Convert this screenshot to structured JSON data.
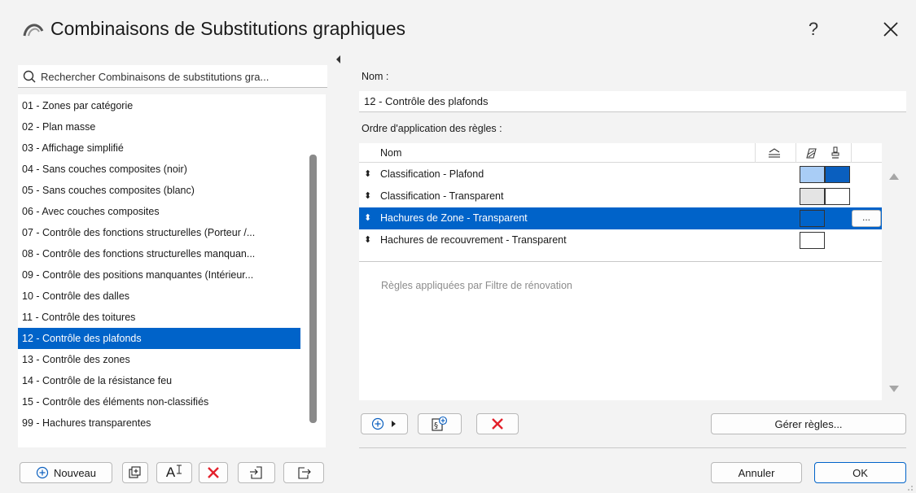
{
  "window": {
    "title": "Combinaisons de Substitutions graphiques",
    "help_label": "?",
    "close_label": "close"
  },
  "sidebar": {
    "search_placeholder": "Rechercher Combinaisons de substitutions gra...",
    "items": [
      "01 - Zones par catégorie",
      "02 - Plan masse",
      "03 - Affichage simplifié",
      "04 - Sans couches composites (noir)",
      "05 - Sans couches composites (blanc)",
      "06 - Avec couches composites",
      "07 - Contrôle des fonctions structurelles (Porteur /...",
      "08 - Contrôle des fonctions structurelles manquan...",
      "09 - Contrôle des positions manquantes (Intérieur...",
      "10 - Contrôle des dalles",
      "11 - Contrôle des toitures",
      "12 - Contrôle des plafonds",
      "13 - Contrôle des zones",
      "14 - Contrôle de la résistance feu",
      "15 - Contrôle des éléments non-classifiés",
      "99 - Hachures transparentes"
    ],
    "selected_index": 11,
    "new_button_label": "Nouveau",
    "rename_icon_text": "A"
  },
  "main": {
    "name_label": "Nom :",
    "name_value": "12 - Contrôle des plafonds",
    "rules_label": "Ordre d'application des règles :",
    "rules_header_name": "Nom",
    "rules": [
      {
        "label": "Classification - Plafond",
        "swatches": [
          "#a9cdf6",
          "#0a5fbf"
        ]
      },
      {
        "label": "Classification - Transparent",
        "swatches": [
          "#e4e4e4",
          "#ffffff"
        ]
      },
      {
        "label": "Hachures de Zone - Transparent",
        "swatches": [
          "#0063c9"
        ],
        "dots": "..."
      },
      {
        "label": "Hachures de recouvrement - Transparent",
        "swatches": [
          "#ffffff"
        ]
      }
    ],
    "selected_rule_index": 2,
    "renovation_text": "Règles appliquées par Filtre de rénovation",
    "manage_rules_label": "Gérer règles...",
    "cancel_label": "Annuler",
    "ok_label": "OK"
  },
  "colors": {
    "selection": "#0063c9",
    "delete_red": "#e3202b",
    "accent_blue": "#0a5fbf"
  }
}
